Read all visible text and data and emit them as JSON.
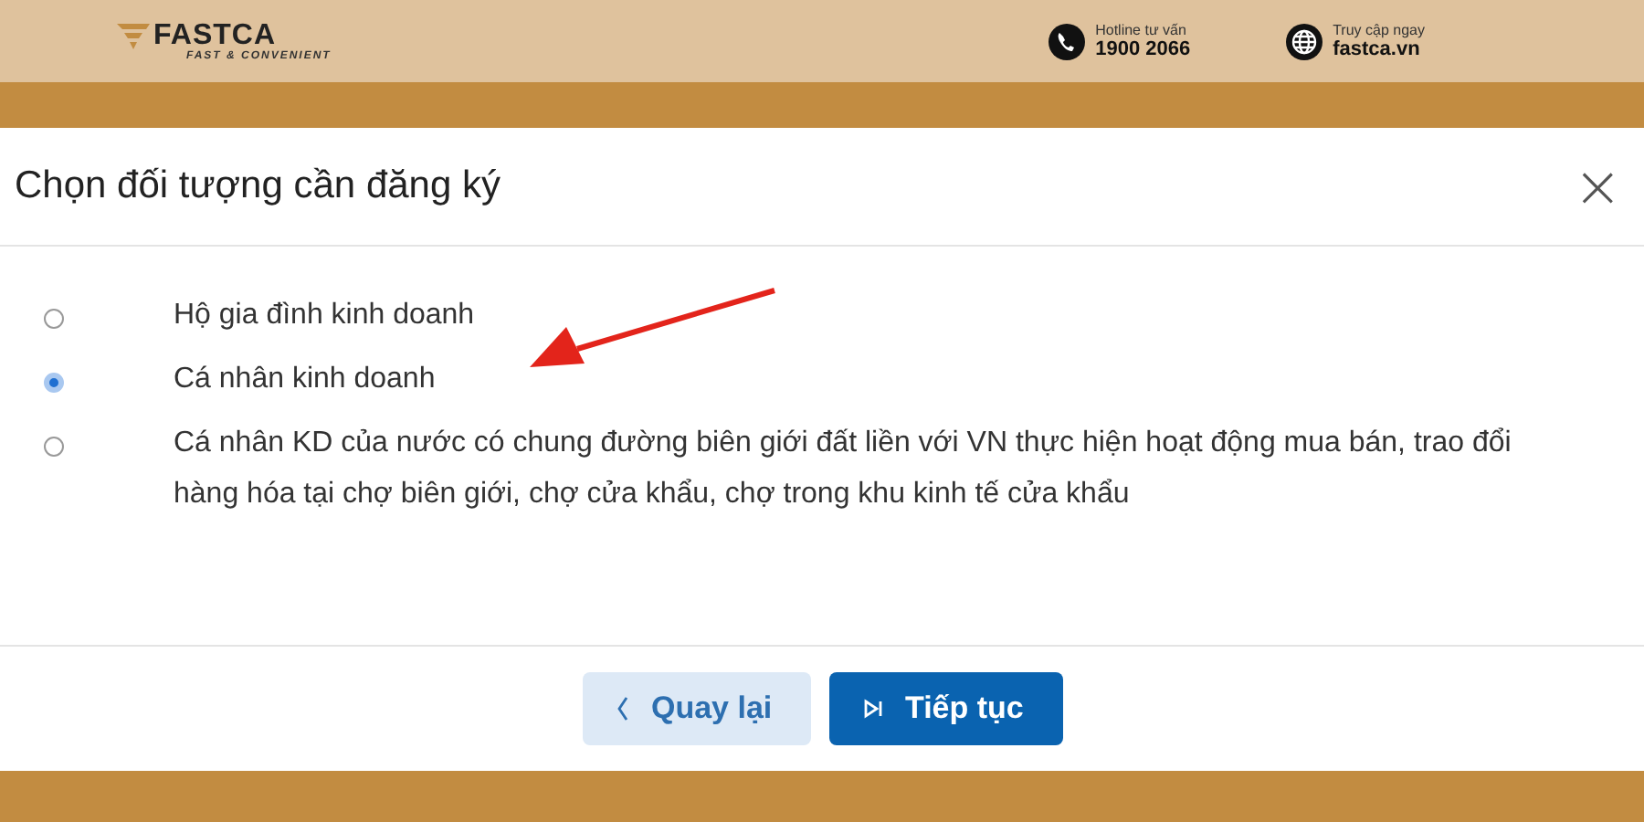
{
  "header": {
    "logo": "FASTCA",
    "tagline": "FAST & CONVENIENT",
    "contacts": [
      {
        "kind": "phone",
        "label": "Hotline tư vấn",
        "value": "1900 2066"
      },
      {
        "kind": "globe",
        "label": "Truy cập ngay",
        "value": "fastca.vn"
      }
    ]
  },
  "dialog": {
    "title": "Chọn đối tượng cần đăng ký",
    "close": "×",
    "options": [
      {
        "label": "Hộ gia đình kinh doanh",
        "selected": false
      },
      {
        "label": "Cá nhân kinh doanh",
        "selected": true
      },
      {
        "label": "Cá nhân KD của nước có chung đường biên giới đất liền với VN thực hiện hoạt động mua bán, trao đổi hàng hóa tại chợ biên giới, chợ cửa khẩu, chợ trong khu kinh tế cửa khẩu",
        "selected": false
      }
    ],
    "buttons": [
      {
        "kind": "back",
        "label": "Quay lại"
      },
      {
        "kind": "next",
        "label": "Tiếp tục"
      }
    ]
  }
}
